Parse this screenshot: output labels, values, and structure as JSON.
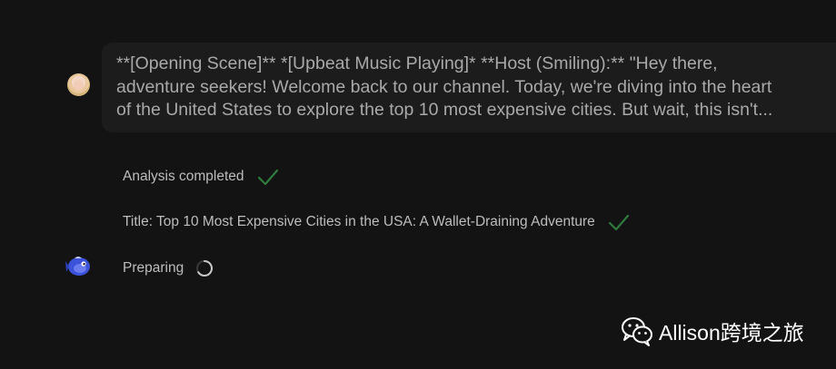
{
  "conversation": {
    "user_message": {
      "lines": [
        "**[Opening Scene]** *[Upbeat Music Playing]* **Host (Smiling):** \"Hey there,",
        "adventure seekers! Welcome back to our channel. Today, we're diving into the heart",
        "of the United States to explore the top 10 most expensive cities. But wait, this isn't..."
      ]
    },
    "steps": [
      {
        "label": "Analysis completed",
        "status": "done",
        "icon": "check-icon"
      },
      {
        "label": "Title: Top 10 Most Expensive Cities in the USA: A Wallet-Draining Adventure",
        "status": "done",
        "icon": "check-icon"
      },
      {
        "label": "Preparing",
        "status": "loading",
        "icon": "spinner-icon"
      }
    ]
  },
  "watermark": {
    "text": "Allison跨境之旅",
    "icon": "wechat-icon"
  },
  "colors": {
    "background": "#131313",
    "bubble": "#1c1c1c",
    "check": "#2f7a3d",
    "bot_avatar": "#3b52d9"
  }
}
